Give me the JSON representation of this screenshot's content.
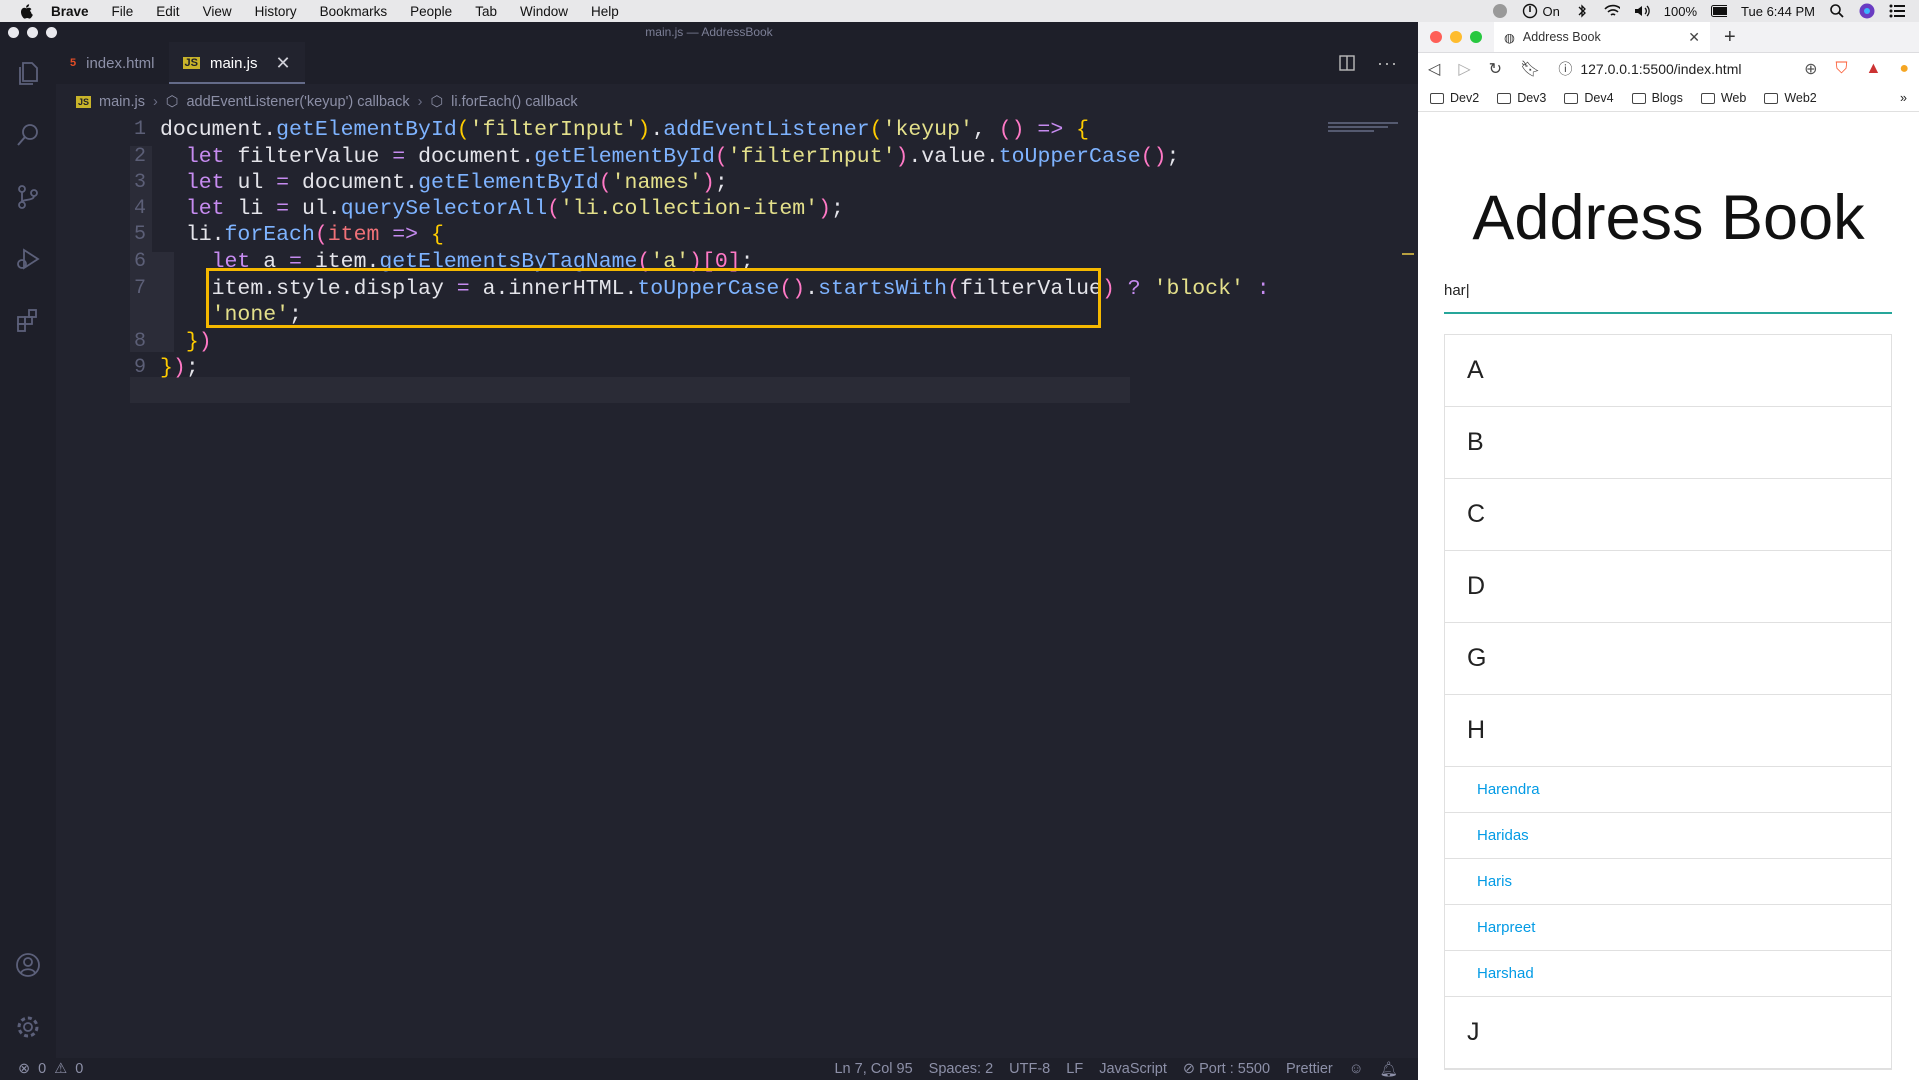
{
  "menubar": {
    "items": [
      "Brave",
      "File",
      "Edit",
      "View",
      "History",
      "Bookmarks",
      "People",
      "Tab",
      "Window",
      "Help"
    ],
    "wifi_label": "On",
    "battery": "100%",
    "clock": "Tue 6:44 PM"
  },
  "vscode": {
    "window_title": "main.js — AddressBook",
    "tabs": [
      {
        "label": "index.html",
        "icon": "html-file-icon"
      },
      {
        "label": "main.js",
        "icon": "js-file-icon"
      }
    ],
    "breadcrumb": [
      "main.js",
      "addEventListener('keyup') callback",
      "li.forEach() callback"
    ],
    "line_numbers": [
      "1",
      "2",
      "3",
      "4",
      "5",
      "6",
      "7",
      "8",
      "9"
    ],
    "status": {
      "problems_errors": "0",
      "problems_warnings": "0",
      "position": "Ln 7, Col 95",
      "spaces": "Spaces: 2",
      "encoding": "UTF-8",
      "eol": "LF",
      "language": "JavaScript",
      "port": "Port : 5500",
      "formatter": "Prettier"
    },
    "code_lines": [
      "document.getElementById('filterInput').addEventListener('keyup', () => {",
      "  let filterValue = document.getElementById('filterInput').value.toUpperCase();",
      "  let ul = document.getElementById('names');",
      "  let li = ul.querySelectorAll('li.collection-item');",
      "  li.forEach(item => {",
      "    let a = item.getElementsByTagName('a')[0];",
      "    item.style.display = a.innerHTML.toUpperCase().startsWith(filterValue) ? 'block' :",
      "    'none';",
      "  })",
      "});"
    ],
    "highlight_color": "#f5b800"
  },
  "browser": {
    "tab_title": "Address Book",
    "url": "127.0.0.1:5500/index.html",
    "bookmarks": [
      "Dev2",
      "Dev3",
      "Dev4",
      "Blogs",
      "Web",
      "Web2"
    ],
    "page": {
      "heading": "Address Book",
      "filter_value": "har",
      "collection": [
        {
          "type": "header",
          "text": "A"
        },
        {
          "type": "header",
          "text": "B"
        },
        {
          "type": "header",
          "text": "C"
        },
        {
          "type": "header",
          "text": "D"
        },
        {
          "type": "header",
          "text": "G"
        },
        {
          "type": "header",
          "text": "H"
        },
        {
          "type": "item",
          "text": "Harendra"
        },
        {
          "type": "item",
          "text": "Haridas"
        },
        {
          "type": "item",
          "text": "Haris"
        },
        {
          "type": "item",
          "text": "Harpreet"
        },
        {
          "type": "item",
          "text": "Harshad"
        },
        {
          "type": "header",
          "text": "J"
        }
      ]
    }
  }
}
